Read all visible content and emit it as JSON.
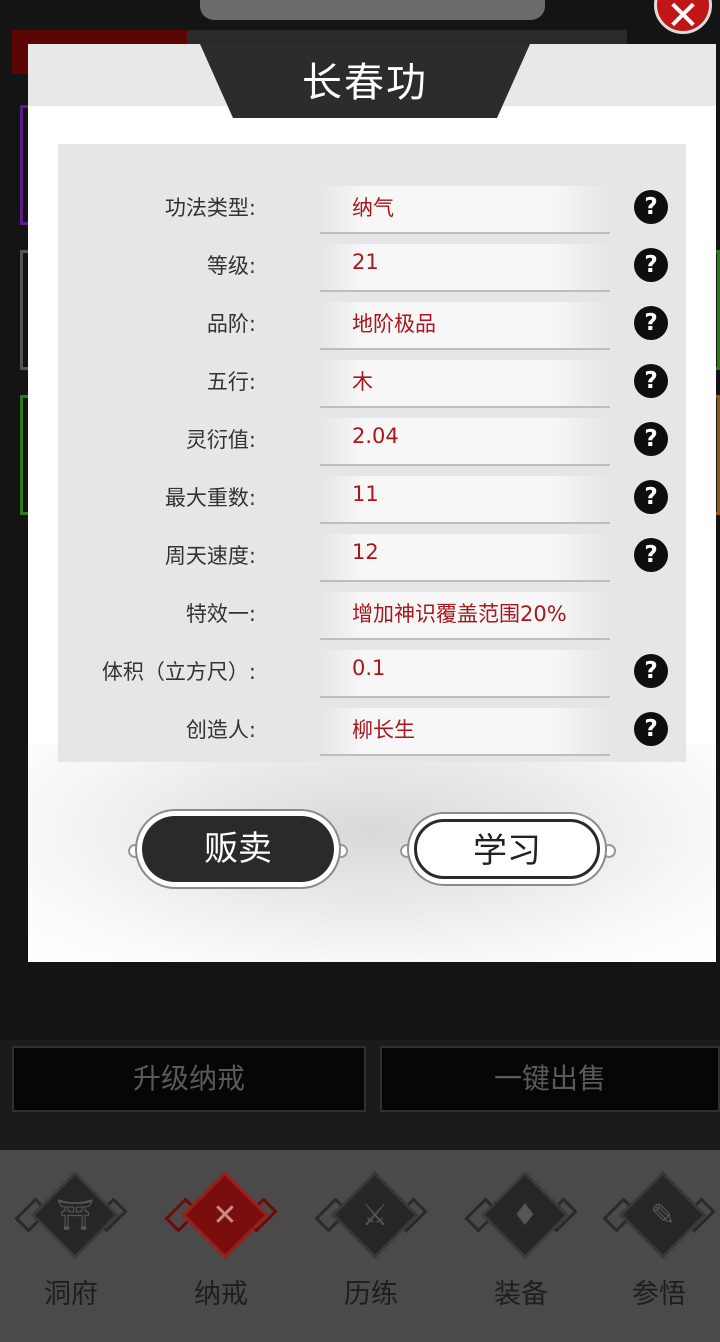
{
  "background": {
    "close_glyph": "✕",
    "actions": {
      "upgrade_label": "升级纳戒",
      "sell_all_label": "一键出售"
    },
    "nav": [
      {
        "label": "洞府",
        "icon": "pavilion-icon",
        "glyph": "⛩",
        "active": false
      },
      {
        "label": "纳戒",
        "icon": "close-cross-icon",
        "glyph": "✕",
        "active": true
      },
      {
        "label": "历练",
        "icon": "crossed-swords-icon",
        "glyph": "⚔",
        "active": false
      },
      {
        "label": "装备",
        "icon": "dagger-icon",
        "glyph": "♦",
        "active": false
      },
      {
        "label": "参悟",
        "icon": "open-book-icon",
        "glyph": "✎",
        "active": false
      }
    ]
  },
  "modal": {
    "title": "长春功",
    "rows": [
      {
        "label": "功法类型:",
        "value": "纳气",
        "help": true
      },
      {
        "label": "等级:",
        "value": "21",
        "help": true
      },
      {
        "label": "品阶:",
        "value": "地阶极品",
        "help": true
      },
      {
        "label": "五行:",
        "value": "木",
        "help": true
      },
      {
        "label": "灵衍值:",
        "value": "2.04",
        "help": true
      },
      {
        "label": "最大重数:",
        "value": "11",
        "help": true
      },
      {
        "label": "周天速度:",
        "value": "12",
        "help": true
      },
      {
        "label": "特效一:",
        "value": "增加神识覆盖范围20%",
        "help": false
      },
      {
        "label": "体积（立方尺）:",
        "value": "0.1",
        "help": true
      },
      {
        "label": "创造人:",
        "value": "柳长生",
        "help": true
      }
    ],
    "help_glyph": "?",
    "sell_label": "贩卖",
    "learn_label": "学习"
  },
  "colors": {
    "value_text": "#a8171c",
    "accent_red": "#c01616"
  }
}
